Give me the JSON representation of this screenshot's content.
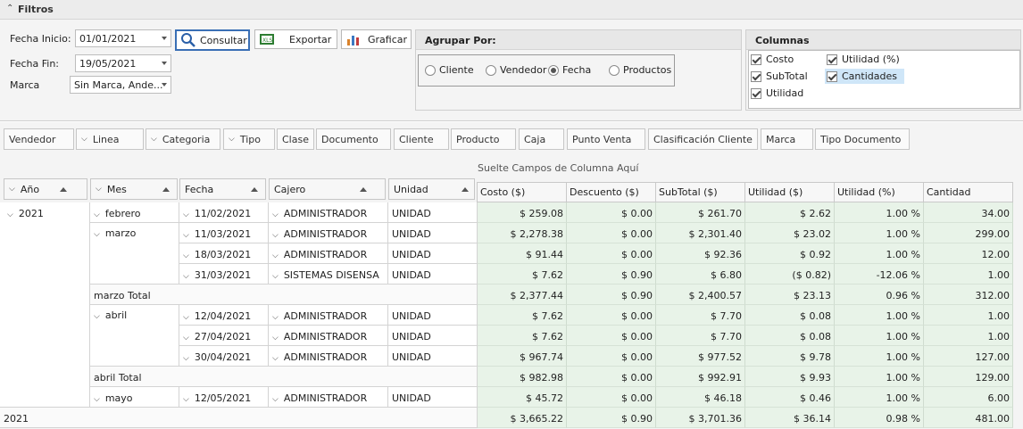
{
  "filtros": {
    "title": "Filtros",
    "fecha_inicio_label": "Fecha Inicio:",
    "fecha_inicio_value": "01/01/2021",
    "fecha_fin_label": "Fecha Fin:",
    "fecha_fin_value": "19/05/2021",
    "marca_label": "Marca",
    "marca_value": "Sin Marca, Ande...",
    "consultar_label": "Consultar",
    "exportar_label": "Exportar",
    "graficar_label": "Graficar"
  },
  "agrupar": {
    "title": "Agrupar Por:",
    "options": [
      "Cliente",
      "Vendedor",
      "Fecha",
      "Productos"
    ],
    "selected": "Fecha"
  },
  "columnas": {
    "title": "Columnas",
    "items": [
      {
        "label": "Costo",
        "checked": true
      },
      {
        "label": "Utilidad (%)",
        "checked": true
      },
      {
        "label": "SubTotal",
        "checked": true
      },
      {
        "label": "Cantidades",
        "checked": true
      },
      {
        "label": "Utilidad",
        "checked": true
      }
    ]
  },
  "filter_fields": [
    "Vendedor",
    "Linea",
    "Categoria",
    "Tipo",
    "Clase",
    "Documento",
    "Cliente",
    "Producto",
    "Caja",
    "Punto Venta",
    "Clasificación Cliente",
    "Marca",
    "Tipo Documento"
  ],
  "drop_hint": "Suelte Campos de Columna Aquí",
  "row_fields": [
    "Año",
    "Mes",
    "Fecha",
    "Cajero",
    "Unidad"
  ],
  "data_columns": [
    "Costo ($)",
    "Descuento ($)",
    "SubTotal ($)",
    "Utilidad ($)",
    "Utilidad (%)",
    "Cantidad"
  ],
  "rows": {
    "year": "2021",
    "months": [
      "febrero",
      "marzo",
      "abril",
      "mayo"
    ],
    "dates": [
      "11/02/2021",
      "11/03/2021",
      "18/03/2021",
      "31/03/2021",
      "12/04/2021",
      "27/04/2021",
      "30/04/2021",
      "12/05/2021"
    ],
    "cajeros": [
      "ADMINISTRADOR",
      "ADMINISTRADOR",
      "ADMINISTRADOR",
      "SISTEMAS DISENSA",
      "ADMINISTRADOR",
      "ADMINISTRADOR",
      "ADMINISTRADOR",
      "ADMINISTRADOR"
    ],
    "unidad": "UNIDAD",
    "marzo_total": "marzo Total",
    "abril_total": "abril Total",
    "year_total": "2021"
  },
  "values": [
    [
      "$ 259.08",
      "$ 0.00",
      "$ 261.70",
      "$ 2.62",
      "1.00 %",
      "34.00"
    ],
    [
      "$ 2,278.38",
      "$ 0.00",
      "$ 2,301.40",
      "$ 23.02",
      "1.00 %",
      "299.00"
    ],
    [
      "$ 91.44",
      "$ 0.00",
      "$ 92.36",
      "$ 0.92",
      "1.00 %",
      "12.00"
    ],
    [
      "$ 7.62",
      "$ 0.90",
      "$ 6.80",
      "($ 0.82)",
      "-12.06 %",
      "1.00"
    ],
    [
      "$ 2,377.44",
      "$ 0.90",
      "$ 2,400.57",
      "$ 23.13",
      "0.96 %",
      "312.00"
    ],
    [
      "$ 7.62",
      "$ 0.00",
      "$ 7.70",
      "$ 0.08",
      "1.00 %",
      "1.00"
    ],
    [
      "$ 7.62",
      "$ 0.00",
      "$ 7.70",
      "$ 0.08",
      "1.00 %",
      "1.00"
    ],
    [
      "$ 967.74",
      "$ 0.00",
      "$ 977.52",
      "$ 9.78",
      "1.00 %",
      "127.00"
    ],
    [
      "$ 982.98",
      "$ 0.00",
      "$ 992.91",
      "$ 9.93",
      "1.00 %",
      "129.00"
    ],
    [
      "$ 45.72",
      "$ 0.00",
      "$ 46.18",
      "$ 0.46",
      "1.00 %",
      "6.00"
    ],
    [
      "$ 3,665.22",
      "$ 0.90",
      "$ 3,701.36",
      "$ 36.14",
      "0.98 %",
      "481.00"
    ]
  ]
}
